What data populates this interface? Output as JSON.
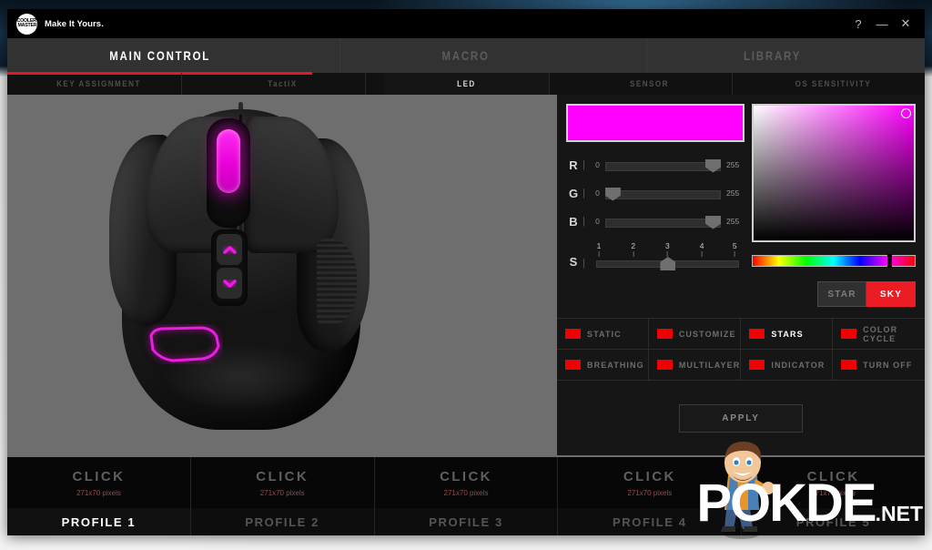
{
  "titlebar": {
    "brand_line1": "COOLER",
    "brand_line2": "MASTER",
    "tagline": "Make It Yours.",
    "help_icon": "?",
    "minimize_icon": "—",
    "close_icon": "✕"
  },
  "main_tabs": [
    {
      "label": "MAIN CONTROL",
      "active": true
    },
    {
      "label": "MACRO",
      "active": false
    },
    {
      "label": "LIBRARY",
      "active": false
    }
  ],
  "sub_tabs": [
    {
      "label": "KEY ASSIGNMENT",
      "active": false
    },
    {
      "label": "TactiX",
      "active": false
    },
    {
      "label": "LED",
      "active": true
    },
    {
      "label": "SENSOR",
      "active": false
    },
    {
      "label": "OS SENSITIVITY",
      "active": false
    }
  ],
  "color_picker": {
    "preview_hex": "#FF00FF",
    "sliders": [
      {
        "label": "R",
        "min": "0",
        "max": "255",
        "value": 255
      },
      {
        "label": "G",
        "min": "0",
        "max": "255",
        "value": 0
      },
      {
        "label": "B",
        "min": "0",
        "max": "255",
        "value": 255
      }
    ],
    "speed": {
      "label": "S",
      "ticks": [
        "1",
        "2",
        "3",
        "4",
        "5"
      ],
      "value": 3
    },
    "hue_position_pct": 83
  },
  "star_sky_toggle": [
    {
      "label": "STAR",
      "active": false
    },
    {
      "label": "SKY",
      "active": true
    }
  ],
  "effects": [
    {
      "label": "STATIC",
      "selected": false,
      "swatch": "#F00000"
    },
    {
      "label": "CUSTOMIZE",
      "selected": false,
      "swatch": "#F00000"
    },
    {
      "label": "STARS",
      "selected": true,
      "swatch": "#F00000"
    },
    {
      "label": "COLOR CYCLE",
      "selected": false,
      "swatch": "#F00000"
    },
    {
      "label": "BREATHING",
      "selected": false,
      "swatch": "#F00000"
    },
    {
      "label": "MULTILAYER",
      "selected": false,
      "swatch": "#F00000"
    },
    {
      "label": "INDICATOR",
      "selected": false,
      "swatch": "#F00000"
    },
    {
      "label": "TURN OFF",
      "selected": false,
      "swatch": "#F00000"
    }
  ],
  "apply_button": "APPLY",
  "profiles": [
    {
      "click": "CLICK",
      "size": "271x70 pixels",
      "name": "PROFILE 1",
      "active": true
    },
    {
      "click": "CLICK",
      "size": "271x70 pixels",
      "name": "PROFILE 2",
      "active": false
    },
    {
      "click": "CLICK",
      "size": "271x70 pixels",
      "name": "PROFILE 3",
      "active": false
    },
    {
      "click": "CLICK",
      "size": "271x70 pixels",
      "name": "PROFILE 4",
      "active": false
    },
    {
      "click": "CLICK",
      "size": "271x70 pixels",
      "name": "PROFILE 5",
      "active": false
    }
  ],
  "watermark": {
    "name": "POKDE",
    "suffix": ".NET"
  },
  "accent_colors": {
    "red": "#E01B24",
    "magenta": "#FF00FF",
    "panel_bg": "#161616",
    "preview_bg": "#6E6E6E"
  }
}
